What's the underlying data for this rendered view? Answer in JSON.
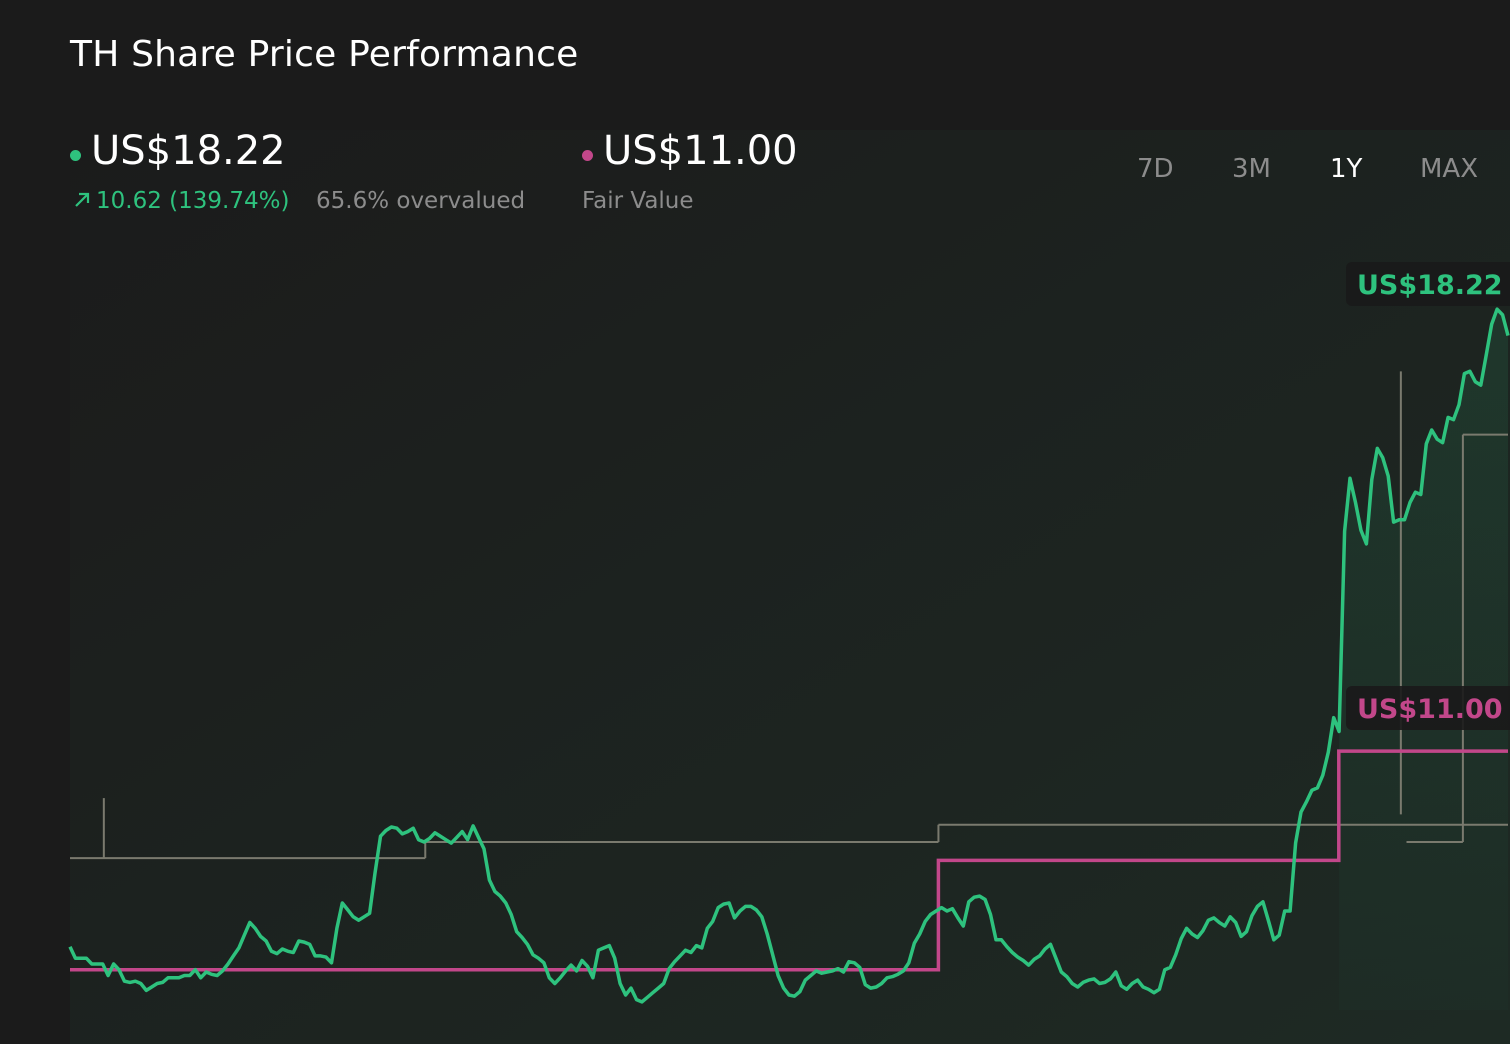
{
  "title": "TH Share Price Performance",
  "price": {
    "value": "US$18.22",
    "change": "10.62 (139.74%)",
    "valuation": "65.6% overvalued",
    "color": "#2ec27e"
  },
  "fair_value": {
    "value": "US$11.00",
    "label": "Fair Value",
    "color": "#c2478a"
  },
  "ranges": [
    "7D",
    "3M",
    "1Y",
    "MAX"
  ],
  "active_range": "1Y",
  "icons": {
    "change": "arrow-up-right-icon"
  },
  "chart_data": {
    "type": "line",
    "title": "TH Share Price Performance",
    "x_range": [
      0,
      255
    ],
    "ylim": [
      6.5,
      19.5
    ],
    "series": [
      {
        "kind": "price",
        "color": "#2ec27e",
        "end_label": "US$18.22",
        "values": [
          7.6,
          7.4,
          7.4,
          7.4,
          7.3,
          7.3,
          7.3,
          7.1,
          7.3,
          7.2,
          7.0,
          6.98,
          7.0,
          6.96,
          6.84,
          6.9,
          6.96,
          6.98,
          7.06,
          7.06,
          7.06,
          7.1,
          7.1,
          7.2,
          7.06,
          7.16,
          7.12,
          7.1,
          7.18,
          7.3,
          7.44,
          7.58,
          7.8,
          8.02,
          7.92,
          7.78,
          7.7,
          7.52,
          7.48,
          7.56,
          7.52,
          7.5,
          7.7,
          7.68,
          7.64,
          7.44,
          7.44,
          7.42,
          7.32,
          7.92,
          8.36,
          8.24,
          8.12,
          8.06,
          8.12,
          8.18,
          8.88,
          9.52,
          9.62,
          9.68,
          9.66,
          9.56,
          9.6,
          9.66,
          9.46,
          9.42,
          9.48,
          9.58,
          9.52,
          9.46,
          9.4,
          9.5,
          9.6,
          9.46,
          9.7,
          9.5,
          9.3,
          8.76,
          8.56,
          8.48,
          8.36,
          8.16,
          7.86,
          7.76,
          7.64,
          7.46,
          7.4,
          7.32,
          7.06,
          6.96,
          7.06,
          7.18,
          7.28,
          7.18,
          7.36,
          7.26,
          7.06,
          7.54,
          7.58,
          7.62,
          7.4,
          6.96,
          6.76,
          6.88,
          6.68,
          6.64,
          6.72,
          6.8,
          6.88,
          6.96,
          7.22,
          7.34,
          7.44,
          7.54,
          7.5,
          7.62,
          7.58,
          7.92,
          8.04,
          8.28,
          8.34,
          8.36,
          8.1,
          8.22,
          8.3,
          8.3,
          8.24,
          8.12,
          7.82,
          7.46,
          7.1,
          6.88,
          6.76,
          6.74,
          6.82,
          7.02,
          7.1,
          7.18,
          7.14,
          7.16,
          7.18,
          7.22,
          7.16,
          7.34,
          7.32,
          7.24,
          6.94,
          6.88,
          6.9,
          6.96,
          7.06,
          7.08,
          7.12,
          7.18,
          7.32,
          7.66,
          7.82,
          8.04,
          8.16,
          8.22,
          8.28,
          8.22,
          8.26,
          8.1,
          7.96,
          8.38,
          8.46,
          8.48,
          8.42,
          8.16,
          7.72,
          7.72,
          7.6,
          7.5,
          7.42,
          7.36,
          7.28,
          7.38,
          7.44,
          7.56,
          7.64,
          7.4,
          7.16,
          7.08,
          6.96,
          6.9,
          6.98,
          7.02,
          7.04,
          6.96,
          6.98,
          7.04,
          7.16,
          6.92,
          6.86,
          6.96,
          7.02,
          6.9,
          6.86,
          6.8,
          6.86,
          7.2,
          7.24,
          7.46,
          7.74,
          7.92,
          7.82,
          7.76,
          7.88,
          8.06,
          8.1,
          8.02,
          7.96,
          8.12,
          8.02,
          7.78,
          7.86,
          8.14,
          8.3,
          8.38,
          8.06,
          7.72,
          7.8,
          8.22,
          8.22,
          9.4,
          9.94,
          10.12,
          10.32,
          10.36,
          10.58,
          10.98,
          11.58,
          11.34,
          14.82,
          15.74,
          15.32,
          14.84,
          14.6,
          15.72,
          16.26,
          16.1,
          15.78,
          14.98,
          15.02,
          15.02,
          15.32,
          15.5,
          15.46,
          16.34,
          16.58,
          16.42,
          16.36,
          16.8,
          16.76,
          17.02,
          17.56,
          17.6,
          17.42,
          17.36,
          17.88,
          18.42,
          18.68,
          18.58,
          18.22
        ]
      }
    ],
    "fair_value_steps": [
      {
        "x_start": 0,
        "x_end": 154,
        "value": 7.2
      },
      {
        "x_start": 154,
        "x_end": 225,
        "value": 9.1
      },
      {
        "x_start": 225,
        "x_end": 255,
        "value": 11.0,
        "end_label": "US$11.00"
      }
    ],
    "analyst_levels": [
      {
        "value": 9.14,
        "range": [
          0,
          63
        ]
      },
      {
        "value": 9.42,
        "range": [
          63,
          154
        ]
      },
      {
        "value": 9.72,
        "range": [
          154,
          255
        ]
      }
    ]
  }
}
